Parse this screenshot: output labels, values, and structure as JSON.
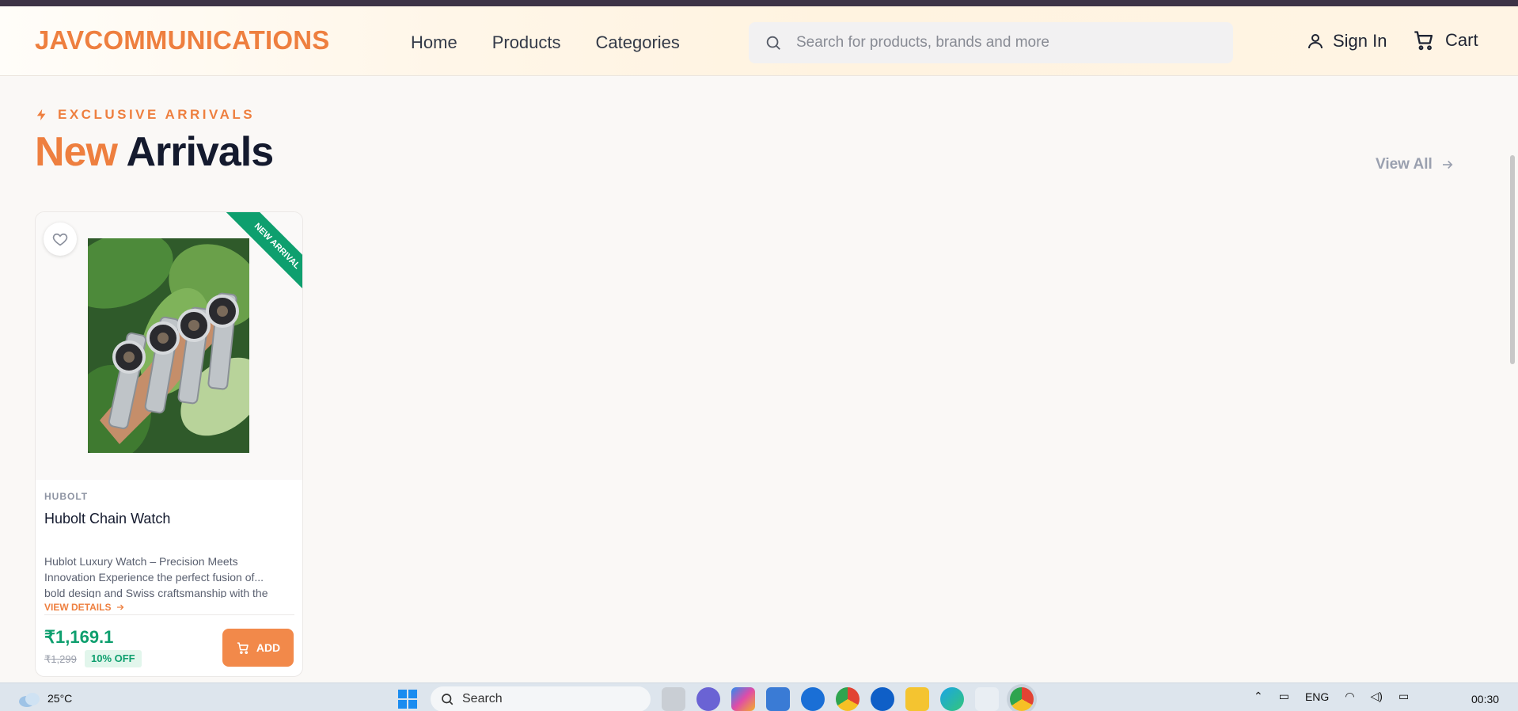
{
  "header": {
    "logo": "JAVCOMMUNICATIONS",
    "nav": [
      "Home",
      "Products",
      "Categories"
    ],
    "search_placeholder": "Search for products, brands and more",
    "signin_label": "Sign In",
    "cart_label": "Cart"
  },
  "section": {
    "tag": "EXCLUSIVE ARRIVALS",
    "title_accent": "New",
    "title_main": "Arrivals",
    "view_all": "View All"
  },
  "products": [
    {
      "ribbon": "NEW ARRIVAL",
      "brand": "HUBOLT",
      "name": "Hubolt Chain Watch",
      "description": "Hublot Luxury Watch – Precision Meets Innovation Experience the perfect fusion of... bold design and Swiss craftsmanship with the",
      "details_label": "VIEW DETAILS",
      "price": "₹1,169.1",
      "old_price": "₹1,299",
      "discount": "10% OFF",
      "add_label": "ADD"
    }
  ],
  "taskbar": {
    "temperature": "25°C",
    "search_label": "Search",
    "language": "ENG",
    "time": "00:30"
  },
  "colors": {
    "accent": "#ee7f3f",
    "success": "#0e9f6e",
    "text_dark": "#141a2e"
  }
}
